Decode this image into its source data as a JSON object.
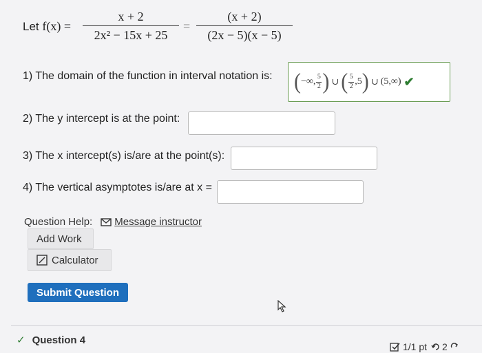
{
  "header": {
    "let_label": "Let",
    "fx": "f(x) =",
    "frac1_num": "x + 2",
    "frac1_den": "2x² − 15x + 25",
    "eq2": "=",
    "frac2_num": "(x + 2)",
    "frac2_den": "(2x − 5)(x − 5)"
  },
  "q1": {
    "text": "1) The domain of the function in interval notation is:",
    "answer": {
      "p1_left": "(",
      "p1_a": "−∞,",
      "f1_num": "5",
      "f1_den": "2",
      "p1_right": ")",
      "cup1": "∪",
      "p2_left": "(",
      "f2_num": "5",
      "f2_den": "2",
      "p2_b": ",5",
      "p2_right": ")",
      "cup2": "∪",
      "p3": "(5,∞)",
      "status": "correct"
    }
  },
  "q2": {
    "text": "2) The y intercept is at the point:",
    "value": ""
  },
  "q3": {
    "text": "3) The x intercept(s) is/are at the point(s):",
    "value": ""
  },
  "q4": {
    "text": "4) The vertical asymptotes is/are at x =",
    "value": ""
  },
  "help": {
    "label": "Question Help:",
    "message_link": "Message instructor",
    "add_work": "Add Work",
    "calculator": "Calculator"
  },
  "submit_label": "Submit Question",
  "footer": {
    "question_label": "Question 4",
    "score": "1/1 pt",
    "retries": "2"
  },
  "colors": {
    "accent": "#1f6fbd",
    "correct": "#2e7d32",
    "answer_border": "#6b9d55"
  }
}
